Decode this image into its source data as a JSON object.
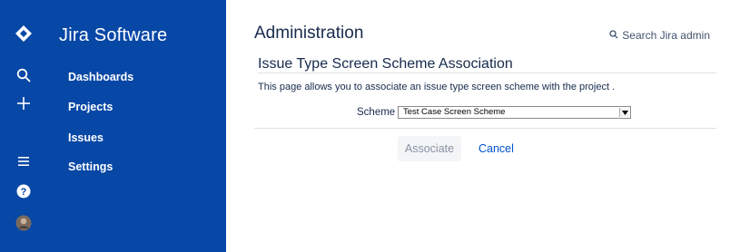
{
  "rail": {
    "icons": [
      "jira-logo-icon",
      "search-icon",
      "create-icon",
      "menu-icon",
      "help-icon",
      "avatar"
    ]
  },
  "sidebar": {
    "product_name": "Jira Software",
    "items": [
      {
        "label": "Dashboards"
      },
      {
        "label": "Projects"
      },
      {
        "label": "Issues"
      },
      {
        "label": "Settings"
      }
    ]
  },
  "header": {
    "title": "Administration",
    "search_label": "Search Jira admin"
  },
  "form": {
    "title": "Issue Type Screen Scheme Association",
    "description": "This page allows you to associate an issue type screen scheme with the project .",
    "scheme_label": "Scheme",
    "scheme_value": "Test Case Screen Scheme",
    "associate_label": "Associate",
    "cancel_label": "Cancel"
  },
  "colors": {
    "sidebar": "#0747a6",
    "link": "#0052cc",
    "text": "#172b4d"
  }
}
